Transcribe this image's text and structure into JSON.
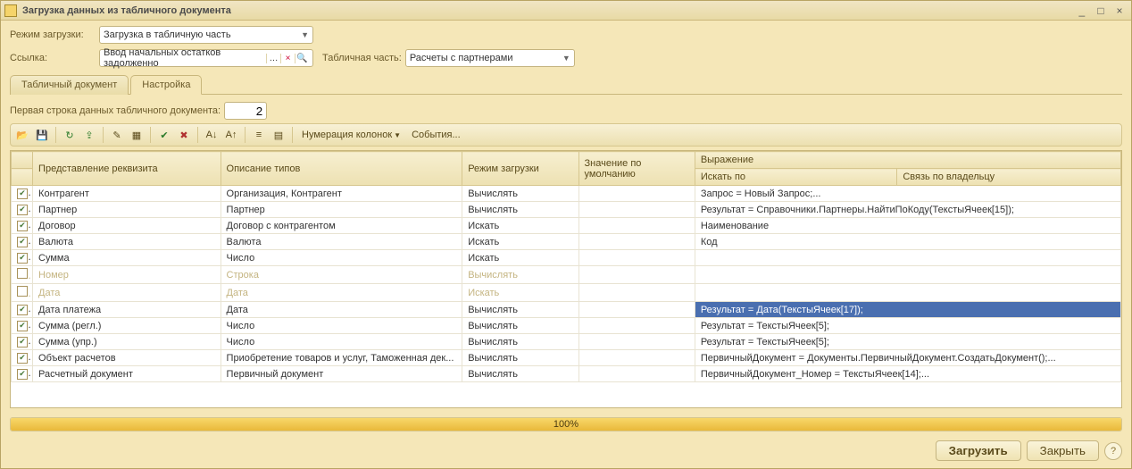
{
  "window": {
    "title": "Загрузка данных из табличного документа"
  },
  "form": {
    "mode_label": "Режим загрузки:",
    "mode_value": "Загрузка в табличную часть",
    "link_label": "Ссылка:",
    "link_value": "Ввод начальных остатков задолженно",
    "tpart_label": "Табличная часть:",
    "tpart_value": "Расчеты с партнерами"
  },
  "tabs": {
    "t1": "Табличный документ",
    "t2": "Настройка"
  },
  "subform": {
    "first_row_label": "Первая строка данных табличного документа:",
    "first_row_value": "2"
  },
  "toolbar": {
    "numbering": "Нумерация колонок",
    "events": "События..."
  },
  "grid": {
    "headers": {
      "repr": "Представление реквизита",
      "types": "Описание типов",
      "mode": "Режим загрузки",
      "default": "Значение по умолчанию",
      "expr": "Выражение",
      "search": "Искать по",
      "owner": "Связь по владельцу"
    },
    "rows": [
      {
        "chk": true,
        "repr": "Контрагент",
        "types": "Организация, Контрагент",
        "mode": "Вычислять",
        "expr": "Запрос = Новый Запрос;..."
      },
      {
        "chk": true,
        "repr": "Партнер",
        "types": "Партнер",
        "mode": "Вычислять",
        "expr": "Результат = Справочники.Партнеры.НайтиПоКоду(ТекстыЯчеек[15]);"
      },
      {
        "chk": true,
        "repr": "Договор",
        "types": "Договор с контрагентом",
        "mode": "Искать",
        "search": "Наименование"
      },
      {
        "chk": true,
        "repr": "Валюта",
        "types": "Валюта",
        "mode": "Искать",
        "search": "Код"
      },
      {
        "chk": true,
        "repr": "Сумма",
        "types": "Число",
        "mode": "Искать"
      },
      {
        "chk": false,
        "repr": "Номер",
        "types": "Строка",
        "mode": "Вычислять",
        "disabled": true
      },
      {
        "chk": false,
        "repr": "Дата",
        "types": "Дата",
        "mode": "Искать",
        "disabled": true
      },
      {
        "chk": true,
        "repr": "Дата платежа",
        "types": "Дата",
        "mode": "Вычислять",
        "expr": "Результат           = Дата(ТекстыЯчеек[17]);",
        "selected": true
      },
      {
        "chk": true,
        "repr": "Сумма (регл.)",
        "types": "Число",
        "mode": "Вычислять",
        "expr": "Результат =  ТекстыЯчеек[5];"
      },
      {
        "chk": true,
        "repr": "Сумма (упр.)",
        "types": "Число",
        "mode": "Вычислять",
        "expr": "Результат =  ТекстыЯчеек[5];"
      },
      {
        "chk": true,
        "repr": "Объект расчетов",
        "types": "Приобретение товаров и услуг, Таможенная дек...",
        "mode": "Вычислять",
        "expr": "ПервичныйДокумент = Документы.ПервичныйДокумент.СоздатьДокумент();..."
      },
      {
        "chk": true,
        "repr": "Расчетный документ",
        "types": "Первичный документ",
        "mode": "Вычислять",
        "expr": "ПервичныйДокумент_Номер = ТекстыЯчеек[14];..."
      }
    ]
  },
  "progress": {
    "pct": "100%"
  },
  "footer": {
    "load": "Загрузить",
    "close": "Закрыть"
  }
}
